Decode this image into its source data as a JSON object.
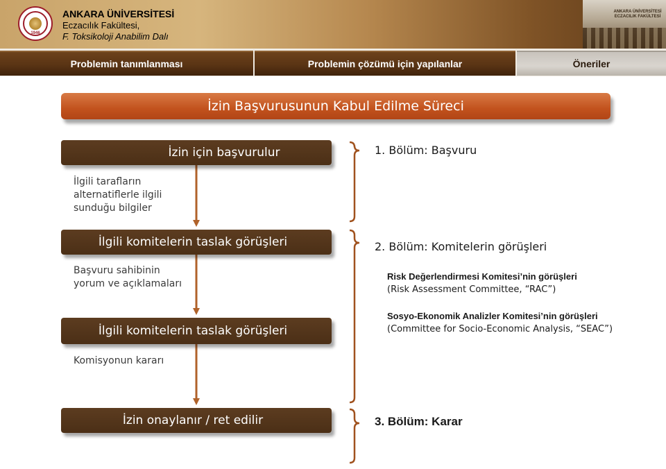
{
  "header": {
    "university": "ANKARA ÜNİVERSİTESİ",
    "faculty": "Eczacılık Fakültesi,",
    "department": "F. Toksikoloji Anabilim Dalı",
    "logo_year": "1946",
    "building_sign": "ANKARA ÜNİVERSİTESİ ECZACILIK FAKÜLTESİ"
  },
  "tabs": [
    {
      "label": "Problemin tanımlanması"
    },
    {
      "label": "Problemin çözümü için yapılanlar"
    },
    {
      "label": "Öneriler"
    }
  ],
  "banner": {
    "title": "İzin Başvurusunun Kabul Edilme Süreci"
  },
  "flow": {
    "step1": "İzin için başvurulur",
    "step2": "İlgili komitelerin taslak görüşleri",
    "step3": "İlgili komitelerin taslak görüşleri",
    "step4": "İzin onaylanır / ret edilir"
  },
  "notes": {
    "alternatives": "İlgili tarafların alternatiflerle ilgili sunduğu bilgiler",
    "applicant": "Başvuru sahibinin yorum ve açıklamaları",
    "commission": "Komisyonun kararı"
  },
  "sections": {
    "s1": "1. Bölüm: Başvuru",
    "s2": "2. Bölüm: Komitelerin görüşleri",
    "s3": "3. Bölüm: Karar",
    "rac_title": "Risk Değerlendirmesi Komitesi’nin görüşleri",
    "rac_sub": "(Risk Assessment Committee, “RAC”)",
    "seac_title": "Sosyo-Ekonomik Analizler Komitesi’nin görüşleri",
    "seac_sub": "(Committee for Socio-Economic Analysis, “SEAC”)"
  },
  "colors": {
    "banner": "#c2521d",
    "box": "#4b2f16",
    "arrow": "#b0622a",
    "bracket": "#a0521e"
  }
}
